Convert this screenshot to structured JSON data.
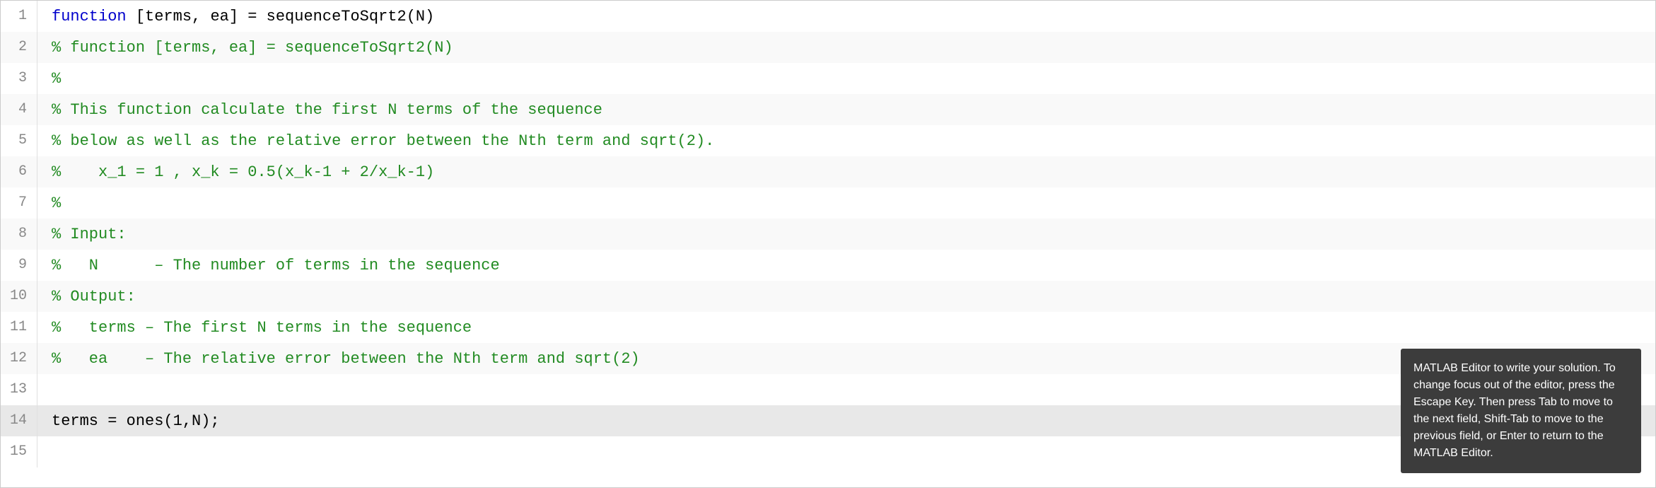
{
  "editor": {
    "lines": [
      {
        "number": "1",
        "parts": [
          {
            "type": "keyword",
            "text": "function"
          },
          {
            "type": "normal",
            "text": " [terms, ea] = sequenceToSqrt2(N)"
          }
        ]
      },
      {
        "number": "2",
        "parts": [
          {
            "type": "comment",
            "text": "% function [terms, ea] = sequenceToSqrt2(N)"
          }
        ]
      },
      {
        "number": "3",
        "parts": [
          {
            "type": "comment",
            "text": "%"
          }
        ]
      },
      {
        "number": "4",
        "parts": [
          {
            "type": "comment",
            "text": "% This function calculate the first N terms of the sequence"
          }
        ]
      },
      {
        "number": "5",
        "parts": [
          {
            "type": "comment",
            "text": "% below as well as the relative error between the Nth term and sqrt(2)."
          }
        ]
      },
      {
        "number": "6",
        "parts": [
          {
            "type": "comment",
            "text": "%    x_1 = 1 , x_k = 0.5(x_k-1 + 2/x_k-1)"
          }
        ]
      },
      {
        "number": "7",
        "parts": [
          {
            "type": "comment",
            "text": "%"
          }
        ]
      },
      {
        "number": "8",
        "parts": [
          {
            "type": "comment",
            "text": "% Input:"
          }
        ]
      },
      {
        "number": "9",
        "parts": [
          {
            "type": "comment",
            "text": "%   N      – The number of terms in the sequence"
          }
        ]
      },
      {
        "number": "10",
        "parts": [
          {
            "type": "comment",
            "text": "% Output:"
          }
        ]
      },
      {
        "number": "11",
        "parts": [
          {
            "type": "comment",
            "text": "%   terms – The first N terms in the sequence"
          }
        ]
      },
      {
        "number": "12",
        "parts": [
          {
            "type": "comment",
            "text": "%   ea    – The relative error between the Nth term and sqrt(2)"
          }
        ]
      },
      {
        "number": "13",
        "parts": [
          {
            "type": "normal",
            "text": ""
          }
        ]
      },
      {
        "number": "14",
        "parts": [
          {
            "type": "normal",
            "text": "terms = ones(1,N);"
          }
        ],
        "highlighted": true
      },
      {
        "number": "15",
        "parts": [
          {
            "type": "normal",
            "text": ""
          }
        ]
      }
    ]
  },
  "tooltip": {
    "text": "MATLAB Editor to write your solution. To change focus out of the editor, press the Escape Key. Then press Tab to move to the next field, Shift-Tab to move to the previous field, or Enter to return to the MATLAB Editor."
  }
}
